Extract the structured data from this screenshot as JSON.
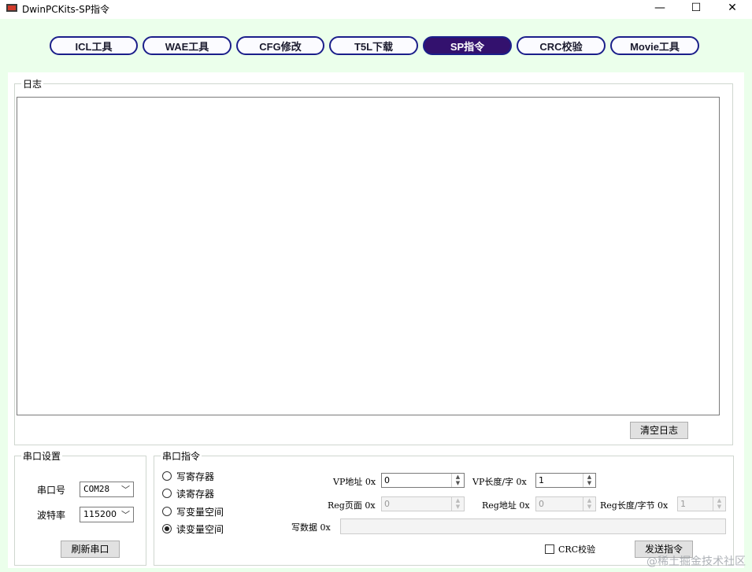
{
  "window": {
    "title": "DwinPCKits-SP指令",
    "minimize": "—",
    "maximize": "☐",
    "close": "✕"
  },
  "tabs": [
    {
      "label": "ICL工具",
      "active": false
    },
    {
      "label": "WAE工具",
      "active": false
    },
    {
      "label": "CFG修改",
      "active": false
    },
    {
      "label": "T5L下载",
      "active": false
    },
    {
      "label": "SP指令",
      "active": true
    },
    {
      "label": "CRC校验",
      "active": false
    },
    {
      "label": "Movie工具",
      "active": false
    }
  ],
  "log": {
    "legend": "日志",
    "content": "",
    "clear_button": "清空日志"
  },
  "serial_settings": {
    "legend": "串口设置",
    "port_label": "串口号",
    "port_value": "COM28",
    "baud_label": "波特率",
    "baud_value": "115200",
    "refresh_button": "刷新串口"
  },
  "serial_command": {
    "legend": "串口指令",
    "radios": [
      {
        "label": "写寄存器",
        "checked": false
      },
      {
        "label": "读寄存器",
        "checked": false
      },
      {
        "label": "写变量空间",
        "checked": false
      },
      {
        "label": "读变量空间",
        "checked": true
      }
    ],
    "vp_addr_label": "VP地址 0x",
    "vp_addr_value": "0",
    "vp_len_label": "VP长度/字 0x",
    "vp_len_value": "1",
    "reg_page_label": "Reg页面 0x",
    "reg_page_value": "0",
    "reg_addr_label": "Reg地址 0x",
    "reg_addr_value": "0",
    "reg_len_label": "Reg长度/字节 0x",
    "reg_len_value": "1",
    "write_data_label": "写数据 0x",
    "write_data_value": "",
    "crc_label": "CRC校验",
    "crc_checked": false,
    "send_button": "发送指令"
  },
  "watermark": "@稀土掘金技术社区"
}
